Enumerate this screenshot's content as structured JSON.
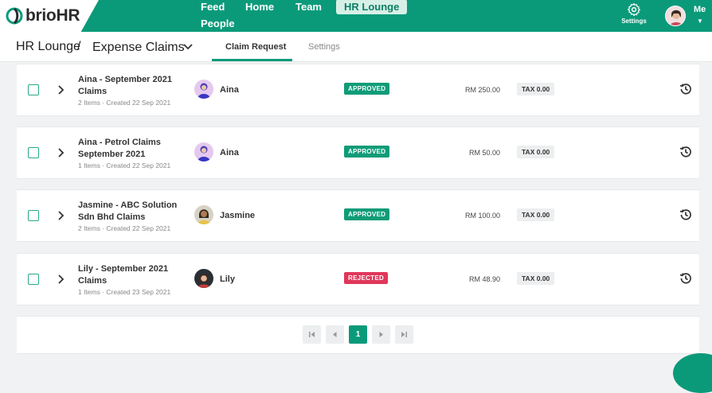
{
  "brand": {
    "logo_text_a": "brio",
    "logo_text_b": "HR",
    "accent": "#0a9a7a"
  },
  "nav": {
    "items": [
      {
        "label": "Feed"
      },
      {
        "label": "Home"
      },
      {
        "label": "Team"
      },
      {
        "label": "HR Lounge",
        "active": true
      },
      {
        "label": "People"
      }
    ],
    "settings_label": "Settings",
    "me_label": "Me"
  },
  "breadcrumb": {
    "root": "HR Lounge",
    "separator": "/",
    "current": "Expense Claims"
  },
  "tabs": [
    {
      "label": "Claim Request",
      "active": true
    },
    {
      "label": "Settings",
      "active": false
    }
  ],
  "claims": [
    {
      "title": "Aina - September 2021 Claims",
      "meta": "2 Items · Created 22 Sep 2021",
      "user": "Aina",
      "avatar_icon": "aina-avatar",
      "status": "APPROVED",
      "amount": "RM 250.00",
      "tax": "TAX 0.00"
    },
    {
      "title": "Aina - Petrol Claims September 2021",
      "meta": "1 Items · Created 22 Sep 2021",
      "user": "Aina",
      "avatar_icon": "aina-avatar",
      "status": "APPROVED",
      "amount": "RM 50.00",
      "tax": "TAX 0.00"
    },
    {
      "title": "Jasmine - ABC Solution Sdn Bhd Claims",
      "meta": "2 Items · Created 22 Sep 2021",
      "user": "Jasmine",
      "avatar_icon": "jasmine-avatar",
      "status": "APPROVED",
      "amount": "RM 100.00",
      "tax": "TAX 0.00"
    },
    {
      "title": "Lily - September 2021 Claims",
      "meta": "1 Items · Created 23 Sep 2021",
      "user": "Lily",
      "avatar_icon": "lily-avatar",
      "status": "REJECTED",
      "amount": "RM 48.90",
      "tax": "TAX 0.00"
    }
  ],
  "pagination": {
    "current_page": "1"
  }
}
